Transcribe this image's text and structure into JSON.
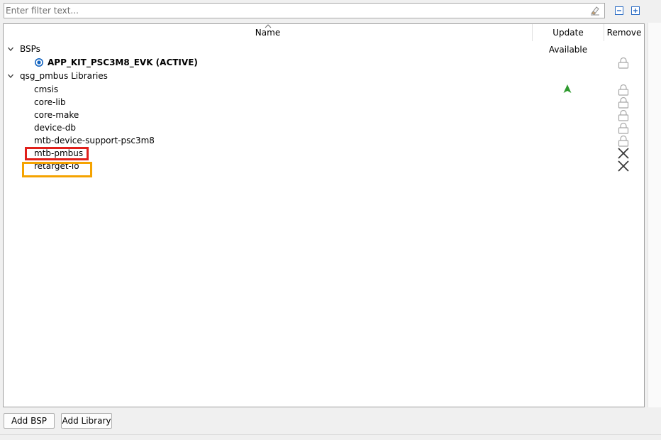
{
  "filter": {
    "placeholder": "Enter filter text..."
  },
  "columns": {
    "name": "Name",
    "update_available": "Update Available",
    "remove": "Remove"
  },
  "tree": {
    "bsps_label": "BSPs",
    "active_bsp": "APP_KIT_PSC3M8_EVK (ACTIVE)",
    "libraries_label": "qsg_pmbus Libraries",
    "libraries": [
      {
        "name": "cmsis",
        "remove": "locked",
        "update_available": true
      },
      {
        "name": "core-lib",
        "remove": "locked"
      },
      {
        "name": "core-make",
        "remove": "locked"
      },
      {
        "name": "device-db",
        "remove": "locked"
      },
      {
        "name": "mtb-device-support-psc3m8",
        "remove": "locked"
      },
      {
        "name": "mtb-pmbus",
        "remove": "removable"
      },
      {
        "name": "retarget-io",
        "remove": "removable"
      }
    ]
  },
  "buttons": {
    "add_bsp": "Add BSP",
    "add_library": "Add Library"
  },
  "colors": {
    "radio": "#1565c0",
    "update_arrow": "#2e9a2e",
    "highlight_red": "#e0201b",
    "highlight_orange": "#f5a300"
  }
}
